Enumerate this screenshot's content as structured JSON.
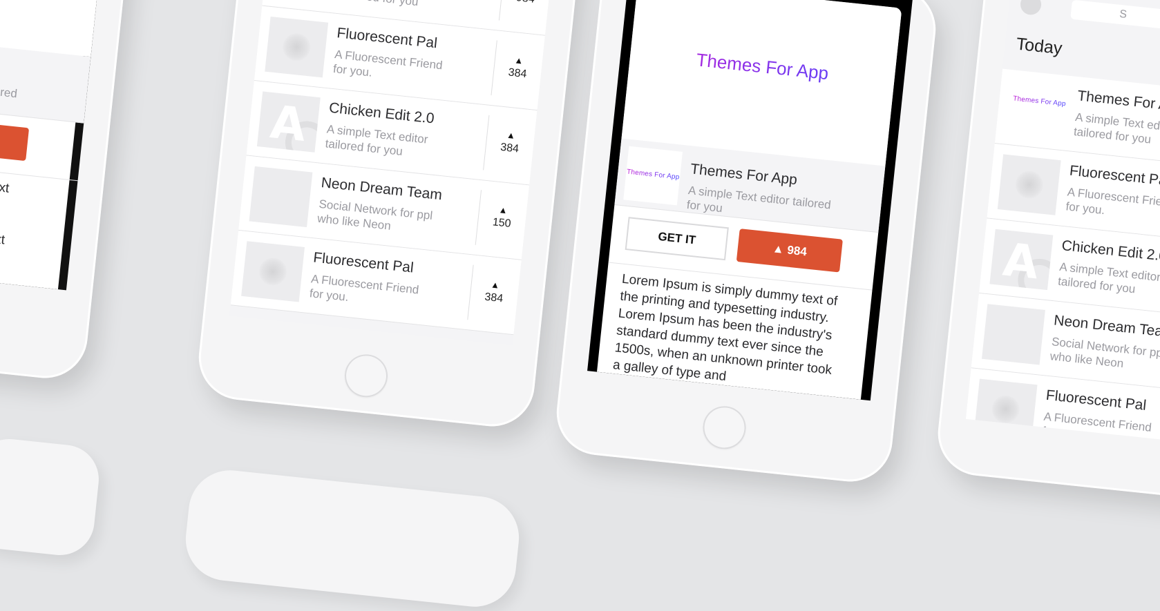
{
  "colors": {
    "accent": "#db5231",
    "logo_gradient_start": "#c21fd6",
    "logo_gradient_end": "#4a47ff",
    "background": "#e4e5e7"
  },
  "brand": {
    "logo_text": "Themes For App"
  },
  "list": {
    "items": [
      {
        "title": "Themes For App",
        "desc": "A simple Text editor tailored for you",
        "votes": "984",
        "thumb": "logo"
      },
      {
        "title": "Fluorescent Pal",
        "desc": "A Fluorescent Friend for you.",
        "votes": "384",
        "thumb": "blob"
      },
      {
        "title": "Chicken Edit 2.0",
        "desc": "A simple Text editor tailored for you",
        "votes": "384",
        "thumb": "letter"
      },
      {
        "title": "Neon Dream Team",
        "desc": "Social Network for ppl who like Neon",
        "votes": "150",
        "thumb": "plain"
      },
      {
        "title": "Fluorescent Pal",
        "desc": "A Fluorescent Friend for you.",
        "votes": "384",
        "thumb": "blob"
      }
    ]
  },
  "detail": {
    "hero_logo": "Themes For App",
    "app_title": "Themes For App",
    "app_desc": "A simple Text editor tailored for you",
    "get_label": "GET IT",
    "upvote_label": "984",
    "upvote_icon": "triangle-up-icon",
    "body": "Lorem Ipsum is simply dummy text of the printing and typesetting industry. Lorem Ipsum has been the industry's standard dummy text ever since the 1500s, when an unknown printer took a galley of type and"
  },
  "today": {
    "title": "Today",
    "search_placeholder": "S"
  }
}
